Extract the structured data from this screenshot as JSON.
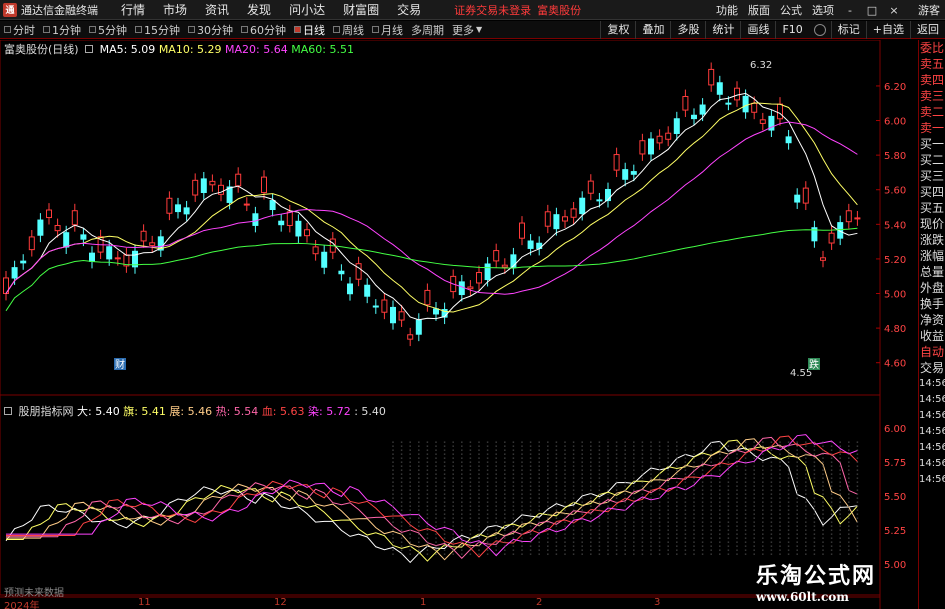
{
  "app": {
    "title": "通达信金融终端"
  },
  "menu": [
    "行情",
    "市场",
    "资讯",
    "发现",
    "问小达",
    "财富圈",
    "交易"
  ],
  "notice": {
    "text": "证券交易未登录",
    "stock": "富奥股份"
  },
  "right_menu": [
    "功能",
    "版面",
    "公式",
    "选项"
  ],
  "guest": "游客",
  "window_controls": [
    "-",
    "□",
    "×"
  ],
  "periods": [
    "分时",
    "1分钟",
    "5分钟",
    "15分钟",
    "30分钟",
    "60分钟",
    "日线",
    "周线",
    "月线",
    "多周期",
    "更多"
  ],
  "active_period": "日线",
  "tools": [
    "复权",
    "叠加",
    "多股",
    "统计",
    "画线",
    "F10",
    "标记",
    "+自选",
    "返回"
  ],
  "main_legend": {
    "name": "富奥股份(日线)",
    "ma5": "MA5: 5.09",
    "ma10": "MA10: 5.29",
    "ma20": "MA20: 5.64",
    "ma60": "MA60: 5.51"
  },
  "sub_legend": {
    "name": "股朋指标网",
    "items": [
      "大: 5.40",
      "旗: 5.41",
      "展: 5.46",
      "热: 5.54",
      "血: 5.63",
      "染: 5.72",
      ": 5.40"
    ]
  },
  "price_axis": [
    "6.20",
    "6.00",
    "5.80",
    "5.60",
    "5.40",
    "5.20",
    "5.00",
    "4.80",
    "4.60"
  ],
  "sub_axis": [
    "6.00",
    "5.75",
    "5.50",
    "5.25",
    "5.00"
  ],
  "annotations": {
    "high": "6.32",
    "low": "4.55",
    "cai": "财",
    "die": "跌"
  },
  "date_labels": [
    "2024年",
    "11",
    "12",
    "1",
    "2",
    "3"
  ],
  "footer_note": "预测未来数据",
  "side_panel": [
    "委比",
    "卖五",
    "卖四",
    "卖三",
    "卖二",
    "卖一",
    "买一",
    "买二",
    "买三",
    "买四",
    "买五",
    "现价",
    "涨跌",
    "涨幅",
    "总量",
    "外盘",
    "换手",
    "净资",
    "收益",
    "自动",
    "交易",
    "14:56",
    "14:56",
    "14:56",
    "14:56",
    "14:56",
    "14:56",
    "14:56"
  ],
  "watermark": {
    "cn": "乐淘公式网",
    "url": "www.60lt.com"
  },
  "colors": {
    "up": "#ff3b3b",
    "down": "#54ffff",
    "ma5": "#ffffff",
    "ma10": "#ffff66",
    "ma20": "#ff44ff",
    "ma60": "#44ff44"
  },
  "chart_data": {
    "type": "candlestick",
    "ylim": [
      4.5,
      6.35
    ],
    "ma_labels": [
      "MA5",
      "MA10",
      "MA20",
      "MA60"
    ]
  }
}
